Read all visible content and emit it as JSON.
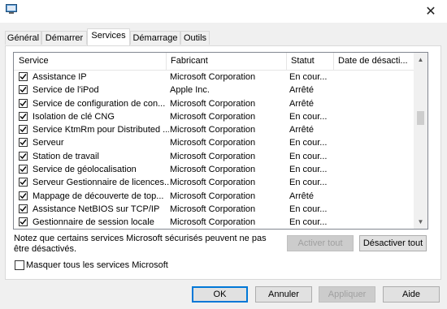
{
  "window": {
    "close_glyph": "✕"
  },
  "tabs": [
    "Général",
    "Démarrer",
    "Services",
    "Démarrage",
    "Outils"
  ],
  "active_tab": "Services",
  "columns": [
    "Service",
    "Fabricant",
    "Statut",
    "Date de désacti..."
  ],
  "services": [
    {
      "name": "Assistance IP",
      "manufacturer": "Microsoft Corporation",
      "status": "En cour...",
      "checked": true
    },
    {
      "name": "Service de l'iPod",
      "manufacturer": "Apple Inc.",
      "status": "Arrêté",
      "checked": true
    },
    {
      "name": "Service de configuration de con...",
      "manufacturer": "Microsoft Corporation",
      "status": "Arrêté",
      "checked": true
    },
    {
      "name": "Isolation de clé CNG",
      "manufacturer": "Microsoft Corporation",
      "status": "En cour...",
      "checked": true
    },
    {
      "name": "Service KtmRm pour Distributed ...",
      "manufacturer": "Microsoft Corporation",
      "status": "Arrêté",
      "checked": true
    },
    {
      "name": "Serveur",
      "manufacturer": "Microsoft Corporation",
      "status": "En cour...",
      "checked": true
    },
    {
      "name": "Station de travail",
      "manufacturer": "Microsoft Corporation",
      "status": "En cour...",
      "checked": true
    },
    {
      "name": "Service de géolocalisation",
      "manufacturer": "Microsoft Corporation",
      "status": "En cour...",
      "checked": true
    },
    {
      "name": "Serveur Gestionnaire de licences...",
      "manufacturer": "Microsoft Corporation",
      "status": "En cour...",
      "checked": true
    },
    {
      "name": "Mappage de découverte de top...",
      "manufacturer": "Microsoft Corporation",
      "status": "Arrêté",
      "checked": true
    },
    {
      "name": "Assistance NetBIOS sur TCP/IP",
      "manufacturer": "Microsoft Corporation",
      "status": "En cour...",
      "checked": true
    },
    {
      "name": "Gestionnaire de session locale",
      "manufacturer": "Microsoft Corporation",
      "status": "En cour...",
      "checked": true
    }
  ],
  "note": "Notez que certains services Microsoft sécurisés peuvent ne pas être désactivés.",
  "buttons": {
    "enable_all": "Activer tout",
    "disable_all": "Désactiver tout",
    "ok": "OK",
    "cancel": "Annuler",
    "apply": "Appliquer",
    "help": "Aide"
  },
  "hide_ms": {
    "label": "Masquer tous les services Microsoft",
    "checked": false
  },
  "scroll": {
    "up": "▲",
    "down": "▼"
  },
  "colors": {
    "accent": "#0078d7",
    "tab_active_bg": "#ffffff",
    "window_bg": "#f0f0f0"
  }
}
